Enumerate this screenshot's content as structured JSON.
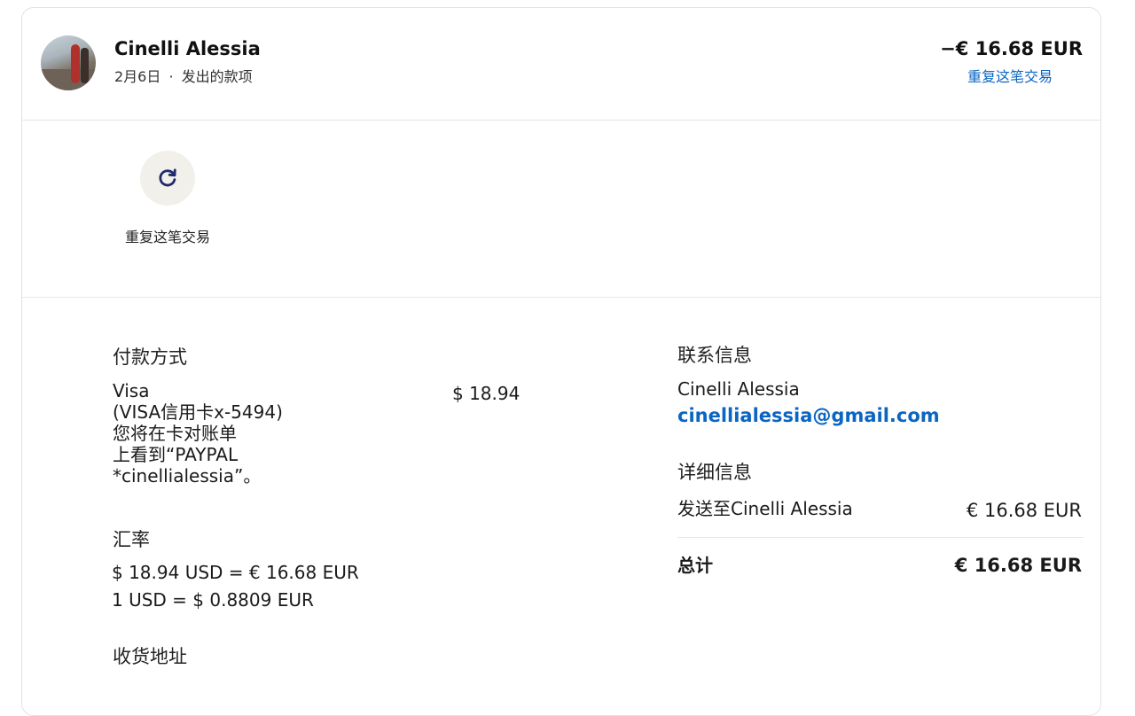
{
  "header": {
    "name": "Cinelli Alessia",
    "date": "2月6日",
    "separator": "·",
    "type": "发出的款项",
    "amount": "−€ 16.68 EUR",
    "repeat_link": "重复这笔交易"
  },
  "actions": {
    "repeat_label": "重复这笔交易"
  },
  "payment": {
    "title": "付款方式",
    "card_name": "Visa",
    "card_line1": "(VISA信用卡x-5494)",
    "card_line2": "您将在卡对账单",
    "card_line3": "上看到“PAYPAL",
    "card_line4": "*cinellialessia”。",
    "card_amount": "$ 18.94"
  },
  "exchange": {
    "title": "汇率",
    "line1": "$ 18.94 USD = € 16.68 EUR",
    "line2": "1 USD = $ 0.8809 EUR"
  },
  "shipping": {
    "title": "收货地址"
  },
  "contact": {
    "title": "联系信息",
    "name": "Cinelli Alessia",
    "email": "cinellialessia@gmail.com"
  },
  "details": {
    "title": "详细信息",
    "sent_to_label": "发送至Cinelli Alessia",
    "sent_to_amount": "€ 16.68 EUR",
    "total_label": "总计",
    "total_amount": "€ 16.68 EUR"
  },
  "colors": {
    "link": "#0a66c2",
    "action_bg": "#f2f0eb",
    "icon": "#1f2a6b"
  }
}
